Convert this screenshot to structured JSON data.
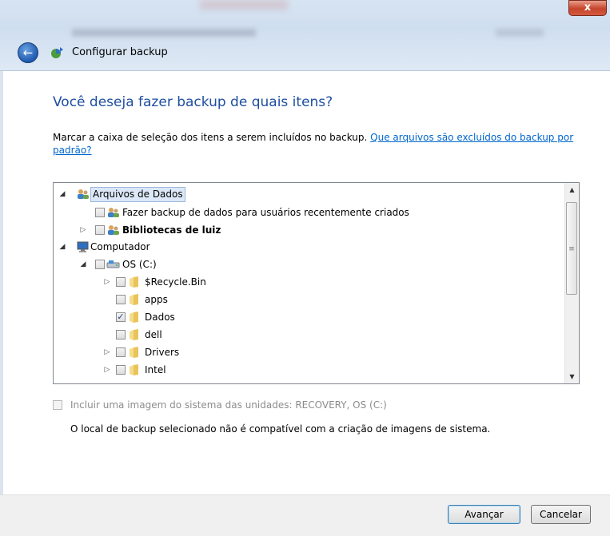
{
  "titlebar": {
    "close_label": "x"
  },
  "header": {
    "title": "Configurar backup"
  },
  "main": {
    "heading": "Você deseja fazer backup de quais itens?",
    "instruction": "Marcar a caixa de seleção dos itens a serem incluídos no backup.",
    "link": "Que arquivos são excluídos do backup por padrão?"
  },
  "tree": {
    "items": [
      {
        "label": "Arquivos de Dados"
      },
      {
        "label": "Fazer backup de dados para usuários recentemente criados",
        "checked": false
      },
      {
        "label": "Bibliotecas de luiz",
        "checked": false
      },
      {
        "label": "Computador"
      },
      {
        "label": "OS (C:)",
        "checked": false
      },
      {
        "label": "$Recycle.Bin",
        "checked": false
      },
      {
        "label": "apps",
        "checked": false
      },
      {
        "label": "Dados",
        "checked": true
      },
      {
        "label": "dell",
        "checked": false
      },
      {
        "label": "Drivers",
        "checked": false
      },
      {
        "label": "Intel",
        "checked": false
      }
    ]
  },
  "system_image": {
    "label": "Incluir uma imagem do sistema das unidades: RECOVERY, OS (C:)",
    "checked": false,
    "enabled": false
  },
  "note": "O local de backup selecionado não é compatível com a criação de imagens de sistema.",
  "footer": {
    "next_label": "Avançar",
    "cancel_label": "Cancelar"
  }
}
